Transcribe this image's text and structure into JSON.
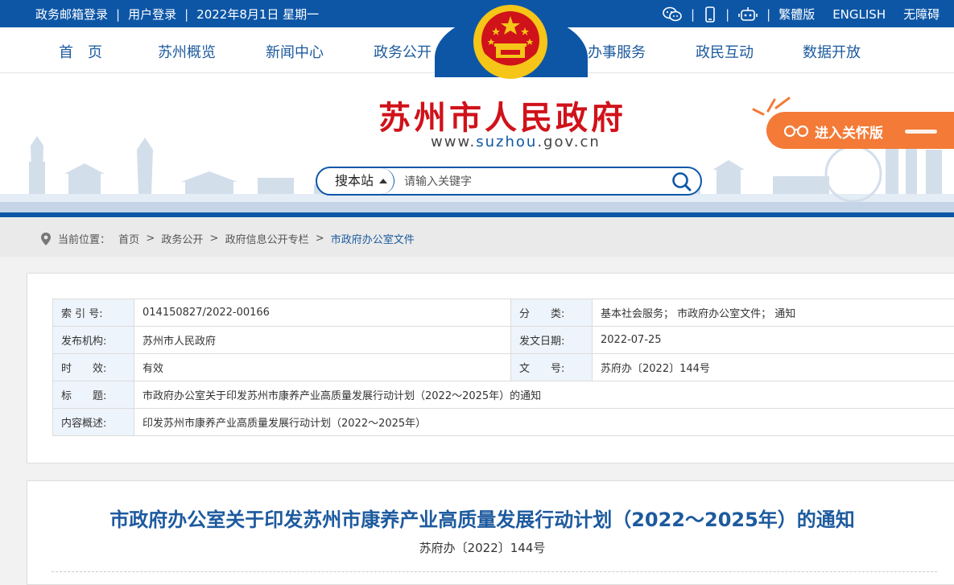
{
  "topbar": {
    "mail_login": "政务邮箱登录",
    "user_login": "用户登录",
    "date": "2022年8月1日 星期一",
    "separator": "|",
    "icons": [
      "wechat-icon",
      "mobile-icon",
      "robot-icon"
    ],
    "traditional": "繁體版",
    "english": "ENGLISH",
    "accessible": "无障碍"
  },
  "nav": {
    "items": [
      "首　页",
      "苏州概览",
      "新闻中心",
      "政务公开",
      "办事服务",
      "政民互动",
      "数据开放"
    ]
  },
  "header": {
    "title": "苏州市人民政府",
    "url_prefix": "www.",
    "url_domain": "suzhou",
    "url_suffix": ".gov.cn",
    "care_button": "进入关怀版"
  },
  "search": {
    "scope": "搜本站",
    "placeholder": "请输入关键字"
  },
  "breadcrumb": {
    "label": "当前位置：",
    "items": [
      "首页",
      "政务公开",
      "政府信息公开专栏",
      "市政府办公室文件"
    ],
    "separator": ">"
  },
  "meta": {
    "index_label": "索 引 号:",
    "index_value": "014150827/2022-00166",
    "category_label": "分　　类:",
    "category_value": "基本社会服务；  市政府办公室文件；  通知",
    "issuer_label": "发布机构:",
    "issuer_value": "苏州市人民政府",
    "date_label": "发文日期:",
    "date_value": "2022-07-25",
    "validity_label": "时　　效:",
    "validity_value": "有效",
    "docno_label": "文　　号:",
    "docno_value": "苏府办〔2022〕144号",
    "title_label": "标　　题:",
    "title_value": "市政府办公室关于印发苏州市康养产业高质量发展行动计划（2022～2025年）的通知",
    "summary_label": "内容概述:",
    "summary_value": "印发苏州市康养产业高质量发展行动计划（2022～2025年）"
  },
  "article": {
    "title": "市政府办公室关于印发苏州市康养产业高质量发展行动计划（2022～2025年）的通知",
    "doc_number": "苏府办〔2022〕144号"
  },
  "colors": {
    "brand_blue": "#0d56a6",
    "title_red": "#d0121a",
    "care_orange": "#f37a37"
  }
}
